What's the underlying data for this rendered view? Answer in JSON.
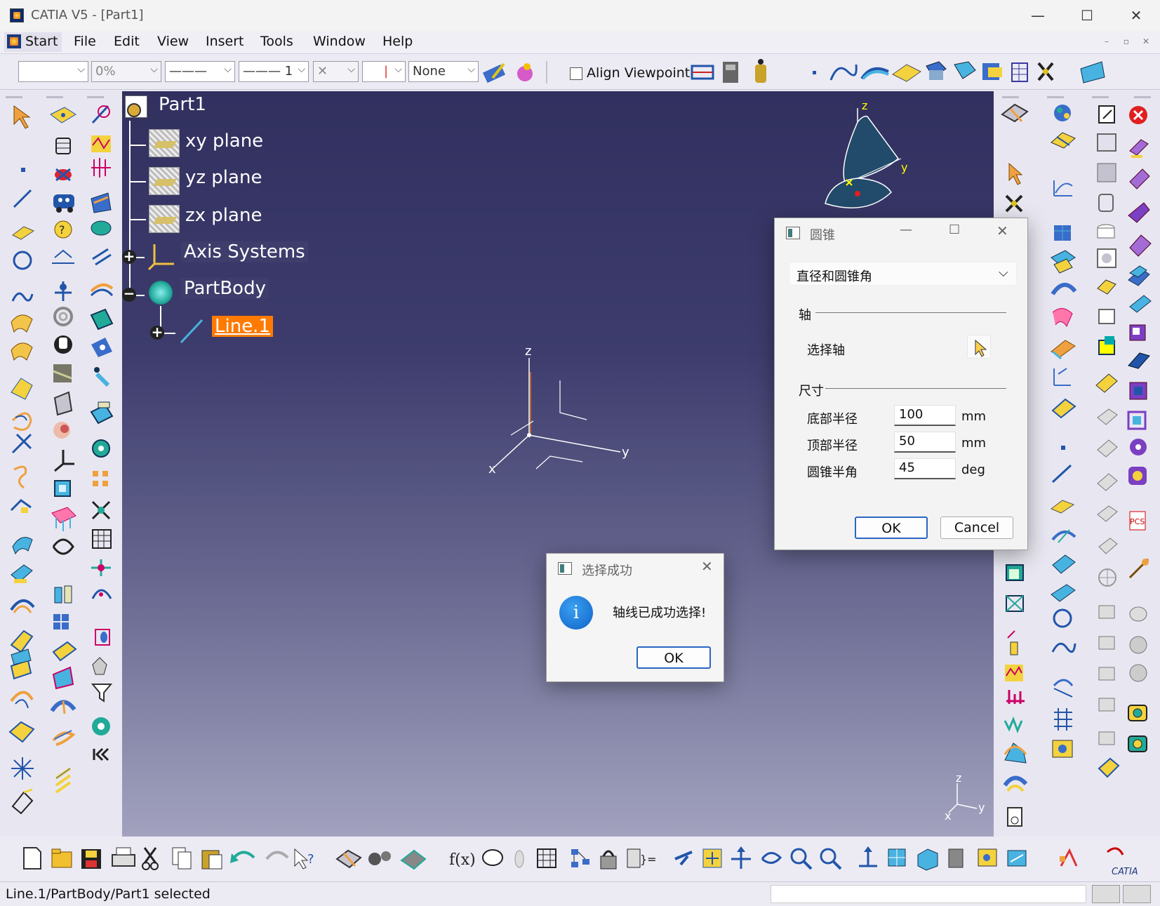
{
  "window": {
    "title": "CATIA V5 - [Part1]",
    "minimize": "—",
    "maximize": "☐",
    "close": "✕"
  },
  "menu": {
    "start": "Start",
    "file": "File",
    "edit": "Edit",
    "view": "View",
    "insert": "Insert",
    "tools": "Tools",
    "window": "Window",
    "help": "Help"
  },
  "toolbar": {
    "color_value": "",
    "transparency_value": "0%",
    "line_width_value": "———",
    "line_type_value": "——— 1",
    "point_type_value": "✕",
    "layer_value": "|",
    "render_style_value": "None",
    "align_viewpoint_label": "Align Viewpoint"
  },
  "tree": {
    "root": "Part1",
    "items": [
      {
        "label": "xy plane"
      },
      {
        "label": "yz plane"
      },
      {
        "label": "zx plane"
      },
      {
        "label": "Axis Systems"
      },
      {
        "label": "PartBody"
      },
      {
        "label": "Line.1"
      }
    ]
  },
  "axes": {
    "z": "z",
    "y": "y",
    "x": "x"
  },
  "cone_dialog": {
    "title": "圆锥",
    "mode_selected": "直径和圆锥角",
    "axis_section": "轴",
    "select_axis_label": "选择轴",
    "dimension_section": "尺寸",
    "fields": [
      {
        "label": "底部半径",
        "value": "100",
        "unit": "mm"
      },
      {
        "label": "顶部半径",
        "value": "50",
        "unit": "mm"
      },
      {
        "label": "圆锥半角",
        "value": "45",
        "unit": "deg"
      }
    ],
    "ok_label": "OK",
    "cancel_label": "Cancel"
  },
  "message_box": {
    "title": "选择成功",
    "message": "轴线已成功选择!",
    "ok_label": "OK",
    "info_glyph": "i"
  },
  "status": {
    "text": "Line.1/PartBody/Part1 selected"
  },
  "brand": {
    "logo_text": "CATIA"
  },
  "colors": {
    "viewport_top": "#31305f",
    "viewport_bottom": "#a2a2bf",
    "selection": "#ff7a00",
    "accent": "#2a66c2"
  }
}
